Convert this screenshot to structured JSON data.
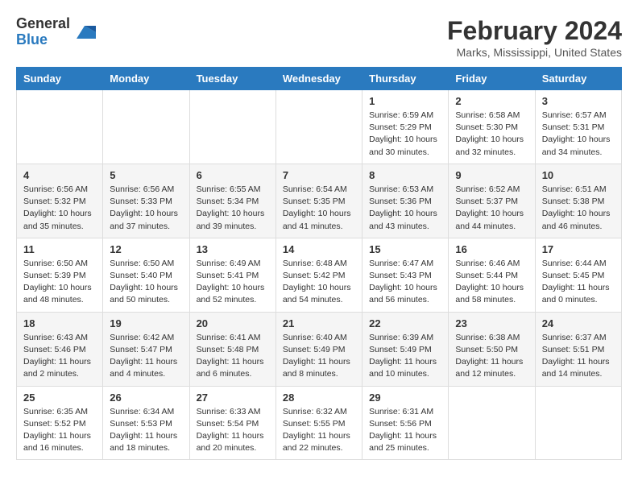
{
  "logo": {
    "general": "General",
    "blue": "Blue"
  },
  "title": "February 2024",
  "subtitle": "Marks, Mississippi, United States",
  "days_of_week": [
    "Sunday",
    "Monday",
    "Tuesday",
    "Wednesday",
    "Thursday",
    "Friday",
    "Saturday"
  ],
  "weeks": [
    [
      {
        "day": "",
        "info": ""
      },
      {
        "day": "",
        "info": ""
      },
      {
        "day": "",
        "info": ""
      },
      {
        "day": "",
        "info": ""
      },
      {
        "day": "1",
        "info": "Sunrise: 6:59 AM\nSunset: 5:29 PM\nDaylight: 10 hours\nand 30 minutes."
      },
      {
        "day": "2",
        "info": "Sunrise: 6:58 AM\nSunset: 5:30 PM\nDaylight: 10 hours\nand 32 minutes."
      },
      {
        "day": "3",
        "info": "Sunrise: 6:57 AM\nSunset: 5:31 PM\nDaylight: 10 hours\nand 34 minutes."
      }
    ],
    [
      {
        "day": "4",
        "info": "Sunrise: 6:56 AM\nSunset: 5:32 PM\nDaylight: 10 hours\nand 35 minutes."
      },
      {
        "day": "5",
        "info": "Sunrise: 6:56 AM\nSunset: 5:33 PM\nDaylight: 10 hours\nand 37 minutes."
      },
      {
        "day": "6",
        "info": "Sunrise: 6:55 AM\nSunset: 5:34 PM\nDaylight: 10 hours\nand 39 minutes."
      },
      {
        "day": "7",
        "info": "Sunrise: 6:54 AM\nSunset: 5:35 PM\nDaylight: 10 hours\nand 41 minutes."
      },
      {
        "day": "8",
        "info": "Sunrise: 6:53 AM\nSunset: 5:36 PM\nDaylight: 10 hours\nand 43 minutes."
      },
      {
        "day": "9",
        "info": "Sunrise: 6:52 AM\nSunset: 5:37 PM\nDaylight: 10 hours\nand 44 minutes."
      },
      {
        "day": "10",
        "info": "Sunrise: 6:51 AM\nSunset: 5:38 PM\nDaylight: 10 hours\nand 46 minutes."
      }
    ],
    [
      {
        "day": "11",
        "info": "Sunrise: 6:50 AM\nSunset: 5:39 PM\nDaylight: 10 hours\nand 48 minutes."
      },
      {
        "day": "12",
        "info": "Sunrise: 6:50 AM\nSunset: 5:40 PM\nDaylight: 10 hours\nand 50 minutes."
      },
      {
        "day": "13",
        "info": "Sunrise: 6:49 AM\nSunset: 5:41 PM\nDaylight: 10 hours\nand 52 minutes."
      },
      {
        "day": "14",
        "info": "Sunrise: 6:48 AM\nSunset: 5:42 PM\nDaylight: 10 hours\nand 54 minutes."
      },
      {
        "day": "15",
        "info": "Sunrise: 6:47 AM\nSunset: 5:43 PM\nDaylight: 10 hours\nand 56 minutes."
      },
      {
        "day": "16",
        "info": "Sunrise: 6:46 AM\nSunset: 5:44 PM\nDaylight: 10 hours\nand 58 minutes."
      },
      {
        "day": "17",
        "info": "Sunrise: 6:44 AM\nSunset: 5:45 PM\nDaylight: 11 hours\nand 0 minutes."
      }
    ],
    [
      {
        "day": "18",
        "info": "Sunrise: 6:43 AM\nSunset: 5:46 PM\nDaylight: 11 hours\nand 2 minutes."
      },
      {
        "day": "19",
        "info": "Sunrise: 6:42 AM\nSunset: 5:47 PM\nDaylight: 11 hours\nand 4 minutes."
      },
      {
        "day": "20",
        "info": "Sunrise: 6:41 AM\nSunset: 5:48 PM\nDaylight: 11 hours\nand 6 minutes."
      },
      {
        "day": "21",
        "info": "Sunrise: 6:40 AM\nSunset: 5:49 PM\nDaylight: 11 hours\nand 8 minutes."
      },
      {
        "day": "22",
        "info": "Sunrise: 6:39 AM\nSunset: 5:49 PM\nDaylight: 11 hours\nand 10 minutes."
      },
      {
        "day": "23",
        "info": "Sunrise: 6:38 AM\nSunset: 5:50 PM\nDaylight: 11 hours\nand 12 minutes."
      },
      {
        "day": "24",
        "info": "Sunrise: 6:37 AM\nSunset: 5:51 PM\nDaylight: 11 hours\nand 14 minutes."
      }
    ],
    [
      {
        "day": "25",
        "info": "Sunrise: 6:35 AM\nSunset: 5:52 PM\nDaylight: 11 hours\nand 16 minutes."
      },
      {
        "day": "26",
        "info": "Sunrise: 6:34 AM\nSunset: 5:53 PM\nDaylight: 11 hours\nand 18 minutes."
      },
      {
        "day": "27",
        "info": "Sunrise: 6:33 AM\nSunset: 5:54 PM\nDaylight: 11 hours\nand 20 minutes."
      },
      {
        "day": "28",
        "info": "Sunrise: 6:32 AM\nSunset: 5:55 PM\nDaylight: 11 hours\nand 22 minutes."
      },
      {
        "day": "29",
        "info": "Sunrise: 6:31 AM\nSunset: 5:56 PM\nDaylight: 11 hours\nand 25 minutes."
      },
      {
        "day": "",
        "info": ""
      },
      {
        "day": "",
        "info": ""
      }
    ]
  ]
}
